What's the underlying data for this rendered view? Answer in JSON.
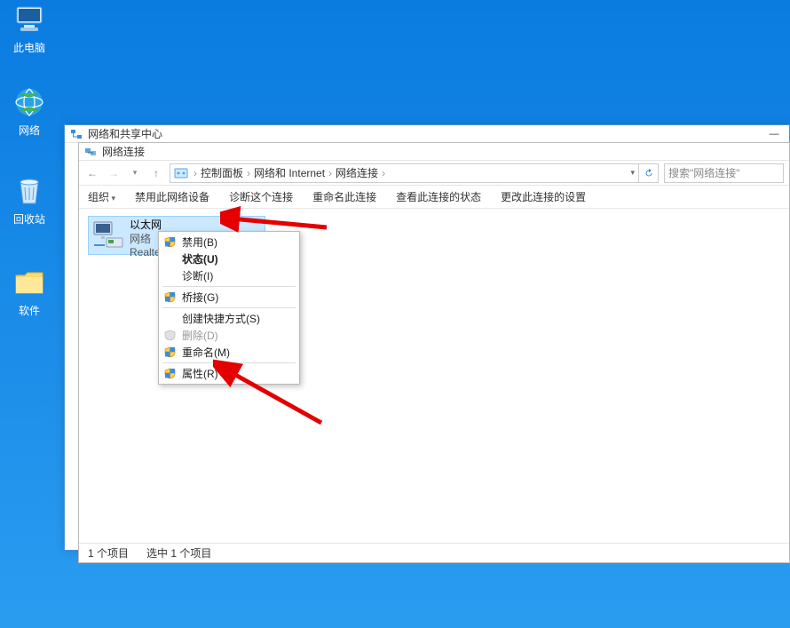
{
  "desktop": {
    "thispc": "此电脑",
    "network": "网络",
    "recycle": "回收站",
    "software": "软件"
  },
  "outer_window": {
    "title": "网络和共享中心"
  },
  "inner_window": {
    "title": "网络连接"
  },
  "breadcrumb": {
    "items": [
      "控制面板",
      "网络和 Internet",
      "网络连接"
    ]
  },
  "search": {
    "placeholder": "搜索\"网络连接\""
  },
  "toolbar": {
    "organize": "组织",
    "disable": "禁用此网络设备",
    "diagnose": "诊断这个连接",
    "rename": "重命名此连接",
    "status": "查看此连接的状态",
    "settings": "更改此连接的设置"
  },
  "adapter": {
    "title": "以太网",
    "sub1": "网络",
    "sub2": "Realtek"
  },
  "contextmenu": {
    "disable": "禁用(B)",
    "status": "状态(U)",
    "diagnose": "诊断(I)",
    "bridge": "桥接(G)",
    "shortcut": "创建快捷方式(S)",
    "delete": "删除(D)",
    "rename": "重命名(M)",
    "properties": "属性(R)"
  },
  "statusbar": {
    "count": "1 个项目",
    "selected": "选中 1 个项目"
  }
}
